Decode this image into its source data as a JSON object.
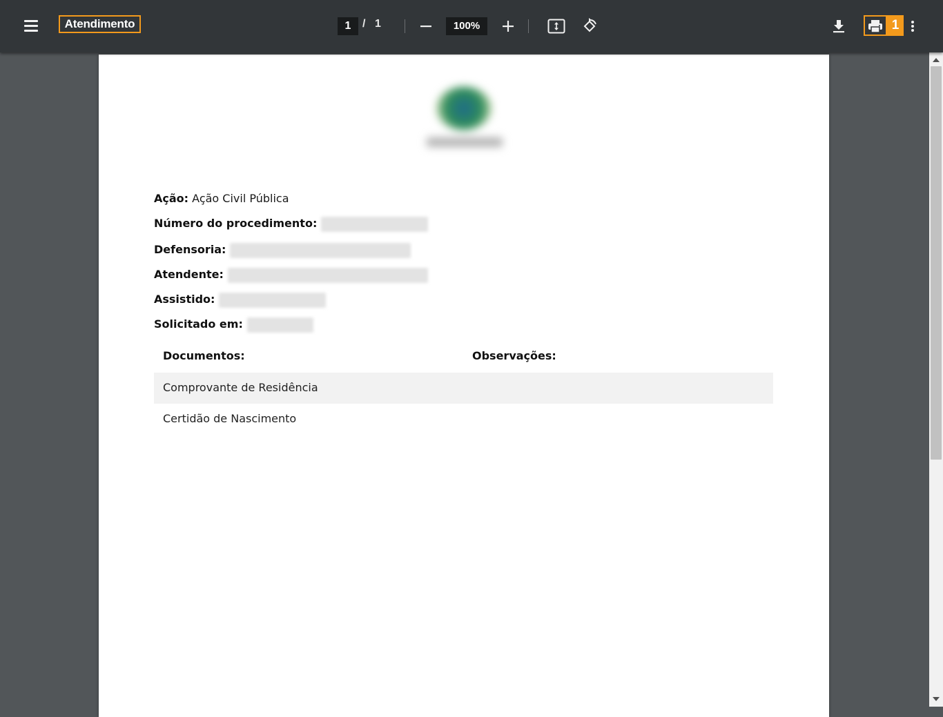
{
  "toolbar": {
    "title": "Atendimento",
    "page_current": "1",
    "page_separator": "/",
    "page_total": "1",
    "zoom": "100%",
    "print_badge": "1",
    "icons": [
      "menu-icon",
      "zoom-out-icon",
      "zoom-in-icon",
      "fit-page-icon",
      "rotate-icon",
      "download-icon",
      "print-icon",
      "more-icon"
    ]
  },
  "document": {
    "fields": [
      {
        "label": "Ação:",
        "value": "Ação Civil Pública",
        "redacted": false
      },
      {
        "label": "Número do procedimento:",
        "value": "",
        "redacted": true
      },
      {
        "label": "Defensoria:",
        "value": "",
        "redacted": true
      },
      {
        "label": "Atendente:",
        "value": "",
        "redacted": true
      },
      {
        "label": "Assistido:",
        "value": "",
        "redacted": true
      },
      {
        "label": "Solicitado em:",
        "value": "",
        "redacted": true
      }
    ],
    "table": {
      "headers": [
        "Documentos:",
        "Observações:"
      ],
      "rows": [
        {
          "document": "Comprovante de Residência",
          "observation": ""
        },
        {
          "document": "Certidão de Nascimento",
          "observation": ""
        }
      ]
    }
  },
  "colors": {
    "toolbar_bg": "#323639",
    "viewer_bg": "#525659",
    "highlight": "#f39a1c"
  }
}
